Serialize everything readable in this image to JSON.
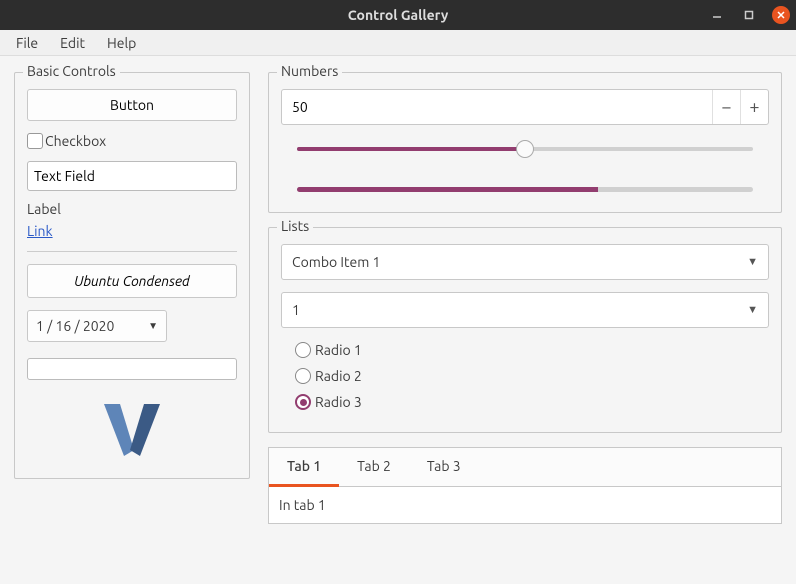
{
  "window": {
    "title": "Control Gallery"
  },
  "menubar": {
    "file": "File",
    "edit": "Edit",
    "help": "Help"
  },
  "basic": {
    "legend": "Basic Controls",
    "button_label": "Button",
    "checkbox_label": "Checkbox",
    "textfield_value": "Text Field",
    "label_text": "Label",
    "link_text": "Link",
    "font_button": "Ubuntu Condensed",
    "date": {
      "month": "1",
      "day": "16",
      "year": "2020"
    }
  },
  "numbers": {
    "legend": "Numbers",
    "spin_value": "50",
    "slider_value": 50,
    "progress_value": 66
  },
  "lists": {
    "legend": "Lists",
    "combo1_value": "Combo Item 1",
    "combo2_value": "1",
    "radio": {
      "r1": "Radio 1",
      "r2": "Radio 2",
      "r3": "Radio 3",
      "selected": 3
    }
  },
  "tabs": {
    "items": [
      "Tab 1",
      "Tab 2",
      "Tab 3"
    ],
    "active": 0,
    "content": "In tab 1"
  }
}
